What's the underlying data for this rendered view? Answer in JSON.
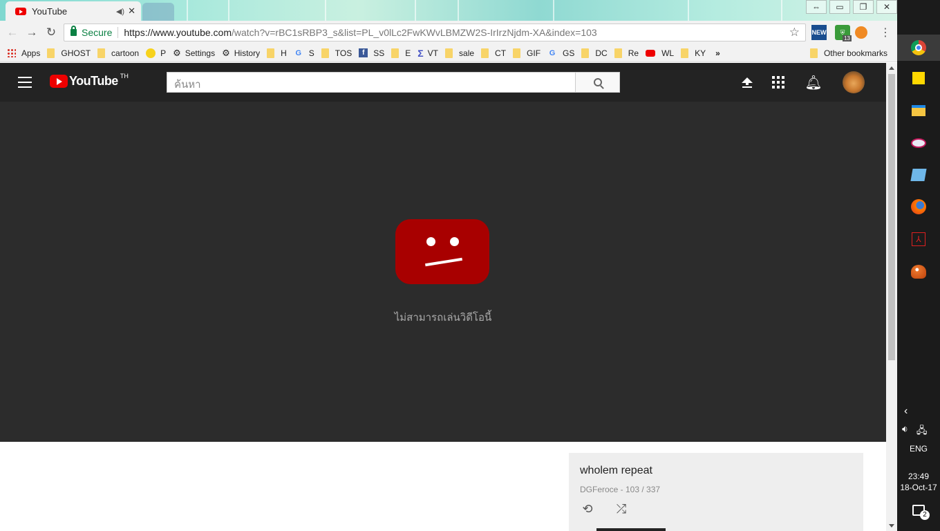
{
  "browser": {
    "tab": {
      "title": "YouTube"
    },
    "address": {
      "secure_label": "Secure",
      "url_host": "https://www.youtube.com",
      "url_rest": "/watch?v=rBC1sRBP3_s&list=PL_v0lLc2FwKWvLBMZW2S-IrIrzNjdm-XA&index=103"
    },
    "extension_badge": "13",
    "extension_news": "NEW",
    "bookmarks": [
      {
        "label": "Apps",
        "icon": "apps-grid-icon"
      },
      {
        "label": "GHOST",
        "icon": "folder-icon"
      },
      {
        "label": "cartoon",
        "icon": "folder-icon"
      },
      {
        "label": "P",
        "icon": "smiley-icon"
      },
      {
        "label": "Settings",
        "icon": "gear-icon"
      },
      {
        "label": "History",
        "icon": "gear-icon"
      },
      {
        "label": "H",
        "icon": "folder-icon"
      },
      {
        "label": "S",
        "icon": "google-icon"
      },
      {
        "label": "TOS",
        "icon": "folder-icon"
      },
      {
        "label": "SS",
        "icon": "facebook-icon"
      },
      {
        "label": "E",
        "icon": "folder-icon"
      },
      {
        "label": "VT",
        "icon": "sigma-icon"
      },
      {
        "label": "sale",
        "icon": "folder-icon"
      },
      {
        "label": "CT",
        "icon": "folder-icon"
      },
      {
        "label": "GIF",
        "icon": "folder-icon"
      },
      {
        "label": "GS",
        "icon": "google-translate-icon"
      },
      {
        "label": "DC",
        "icon": "folder-icon"
      },
      {
        "label": "Re",
        "icon": "folder-icon"
      },
      {
        "label": "WL",
        "icon": "youtube-icon"
      },
      {
        "label": "KY",
        "icon": "folder-icon"
      }
    ],
    "bookmarks_overflow": "»",
    "other_bookmarks": "Other bookmarks"
  },
  "youtube": {
    "logo_text": "YouTube",
    "region": "TH",
    "search_placeholder": "ค้นหา",
    "error_message": "ไม่สามารถเล่นวิดีโอนี้",
    "playlist": {
      "title": "wholem repeat",
      "meta": "DGFeroce - 103 / 337"
    }
  },
  "taskbar": {
    "language": "ENG",
    "time": "23:49",
    "date": "18-Oct-17",
    "notifications": "2"
  },
  "colors": {
    "youtube_red": "#ff0000",
    "error_face": "#a80000",
    "header_bg": "#232323",
    "player_bg": "#2c2c2c",
    "secure_green": "#0b8043"
  }
}
